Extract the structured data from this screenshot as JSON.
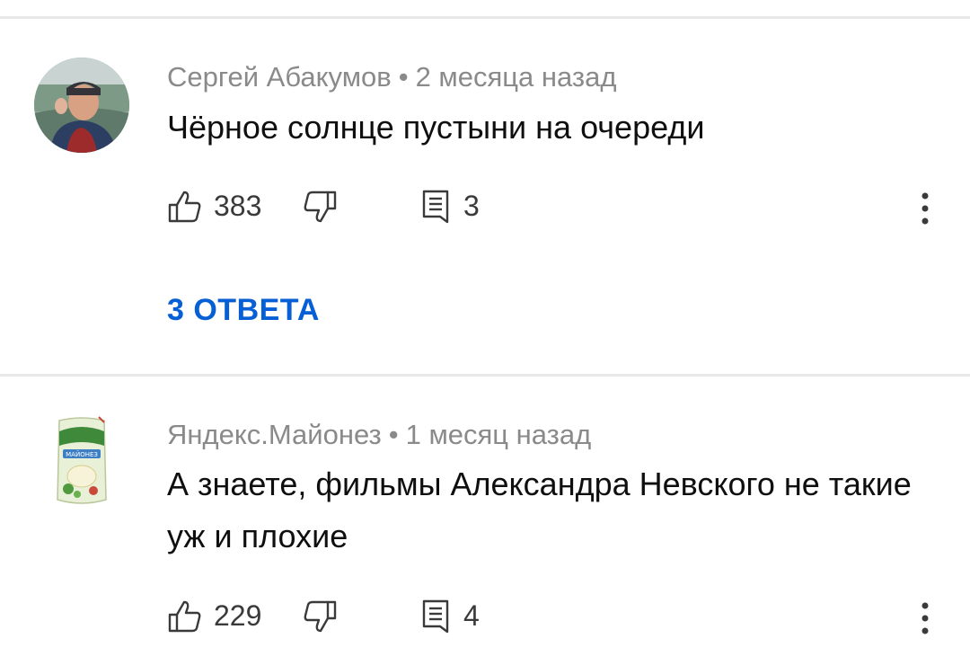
{
  "comments": [
    {
      "author": "Сергей Абакумов",
      "separator": "•",
      "time": "2 месяца назад",
      "text": "Чёрное солнце пустыни на очереди",
      "likes": "383",
      "reply_count": "3",
      "replies_label": "3 ОТВЕТА",
      "avatar_icon": "avatar-photo-man"
    },
    {
      "author": "Яндекс.Майонез",
      "separator": "•",
      "time": "1 месяц назад",
      "text": "А знаете, фильмы Александра Невского не такие уж и плохие",
      "likes": "229",
      "reply_count": "4",
      "avatar_icon": "avatar-mayonnaise-pack",
      "avatar_label": "МАЙОНЕЗ"
    }
  ],
  "colors": {
    "link": "#065fd4",
    "meta": "#8a8a8a",
    "text": "#0f0f0f",
    "divider": "#e8e8e8"
  }
}
